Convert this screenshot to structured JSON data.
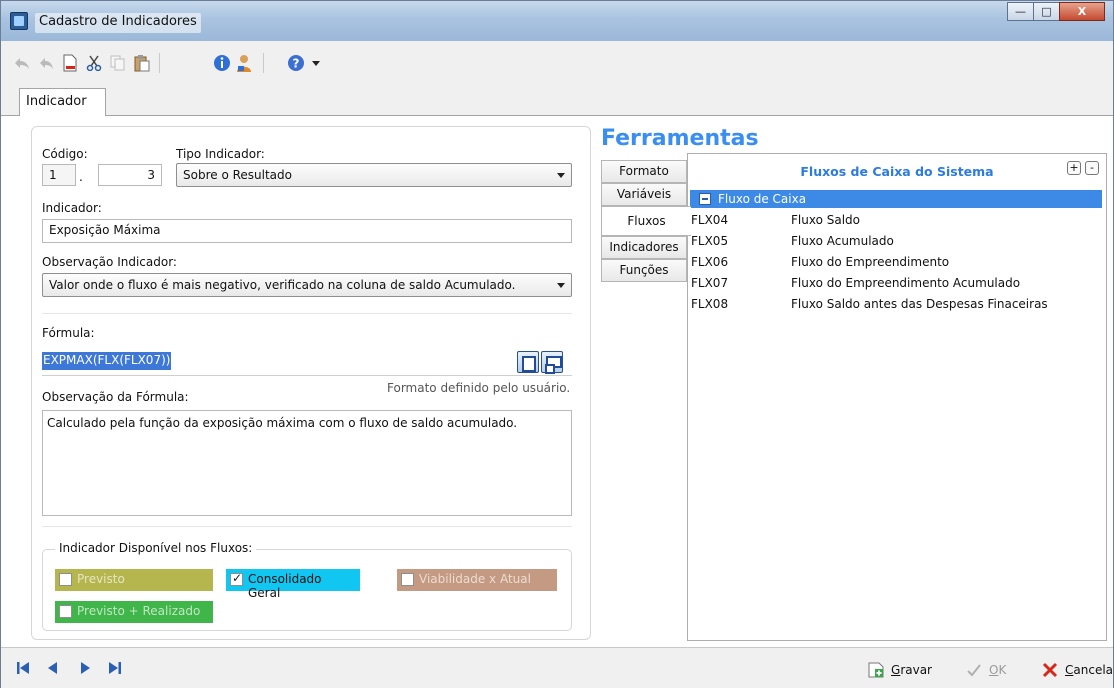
{
  "window": {
    "title": "Cadastro de Indicadores",
    "buttons": {
      "minimize": "—",
      "maximize": "□",
      "close": "X"
    }
  },
  "toolbar": {
    "icons": [
      "reply-icon",
      "reply-all-icon",
      "new-document-icon",
      "cut-icon",
      "copy-icon",
      "paste-icon",
      "info-icon",
      "user-icon",
      "help-icon",
      "dropdown-icon"
    ]
  },
  "tabs": {
    "main": "Indicador"
  },
  "form": {
    "codigo_label": "Código:",
    "codigo_part1": "1",
    "codigo_sep": ".",
    "codigo_part2": "3",
    "tipo_label": "Tipo Indicador:",
    "tipo_value": "Sobre o Resultado",
    "indicador_label": "Indicador:",
    "indicador_value": "Exposição Máxima",
    "obs_ind_label": "Observação Indicador:",
    "obs_ind_value": "Valor onde o fluxo é mais negativo, verificado na coluna de saldo Acumulado.",
    "formula_label": "Fórmula:",
    "formula_value": "EXPMAX(FLX(FLX07))",
    "formato_note": "Formato definido pelo usuário.",
    "obs_formula_label": "Observação da Fórmula:",
    "obs_formula_value": "Calculado pela função da exposição máxima com o fluxo de saldo acumulado.",
    "group_label": "Indicador Disponível nos Fluxos:",
    "checks": [
      {
        "label": "Previsto",
        "checked": false,
        "color": "#b5b64d"
      },
      {
        "label": "Consolidado Geral",
        "checked": true,
        "color": "#11c6f0"
      },
      {
        "label": "Viabilidade x Atual",
        "checked": false,
        "color": "#c49a82"
      },
      {
        "label": "Previsto + Realizado",
        "checked": false,
        "color": "#3fb54a"
      }
    ]
  },
  "tools": {
    "title": "Ferramentas",
    "vtabs": [
      "Formato",
      "Variáveis",
      "Fluxos",
      "Indicadores",
      "Funções"
    ],
    "active_tab": "Fluxos",
    "tree_title": "Fluxos de Caixa do Sistema",
    "plus": "+",
    "minus": "-",
    "group": "Fluxo de Caixa",
    "rows": [
      {
        "code": "FLX04",
        "desc": "Fluxo Saldo"
      },
      {
        "code": "FLX05",
        "desc": "Fluxo Acumulado"
      },
      {
        "code": "FLX06",
        "desc": "Fluxo do Empreendimento"
      },
      {
        "code": "FLX07",
        "desc": "Fluxo do Empreendimento Acumulado"
      },
      {
        "code": "FLX08",
        "desc": "Fluxo Saldo antes das Despesas Finaceiras"
      }
    ]
  },
  "status": {
    "gravar": "Gravar",
    "ok": "OK",
    "cancela": "Cancela"
  },
  "colors": {
    "accent": "#3a8ef0",
    "selection": "#3d78d8"
  }
}
